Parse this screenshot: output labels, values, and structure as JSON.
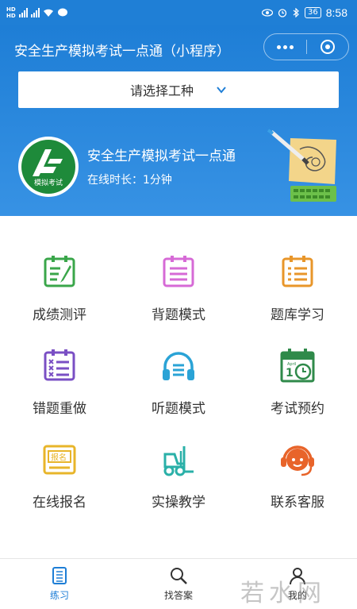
{
  "status_bar": {
    "time": "8:58",
    "battery": "36",
    "signal_badge_1": "HD",
    "signal_badge_2": "HD"
  },
  "header": {
    "app_title": "安全生产模拟考试一点通（小程序）",
    "selector_label": "请选择工种",
    "profile": {
      "name": "安全生产模拟考试一点通",
      "online_label": "在线时长：",
      "online_value": "1分钟",
      "logo_text": "模拟考试"
    },
    "colors": {
      "primary": "#1e7ed6",
      "logo_green": "#1e8a3a"
    }
  },
  "menu": [
    {
      "label": "成绩测评",
      "icon": "score-clipboard-icon",
      "color": "#3aa64a"
    },
    {
      "label": "背题模式",
      "icon": "memorize-clipboard-icon",
      "color": "#d66ad6"
    },
    {
      "label": "题库学习",
      "icon": "question-bank-icon",
      "color": "#e8962a"
    },
    {
      "label": "错题重做",
      "icon": "wrong-questions-icon",
      "color": "#7a4fc4"
    },
    {
      "label": "听题模式",
      "icon": "headphones-icon",
      "color": "#2aa3d6"
    },
    {
      "label": "考试预约",
      "icon": "calendar-clock-icon",
      "color": "#2f8a4a"
    },
    {
      "label": "在线报名",
      "icon": "signup-icon",
      "color": "#e8b52a"
    },
    {
      "label": "实操教学",
      "icon": "forklift-icon",
      "color": "#2ab0a8"
    },
    {
      "label": "联系客服",
      "icon": "customer-service-icon",
      "color": "#e8642a"
    }
  ],
  "tabbar": {
    "tabs": [
      {
        "label": "练习",
        "icon": "practice-icon",
        "active": true
      },
      {
        "label": "找答案",
        "icon": "search-icon",
        "active": false
      },
      {
        "label": "我的",
        "icon": "user-icon",
        "active": false
      }
    ],
    "watermark": "若水网"
  }
}
